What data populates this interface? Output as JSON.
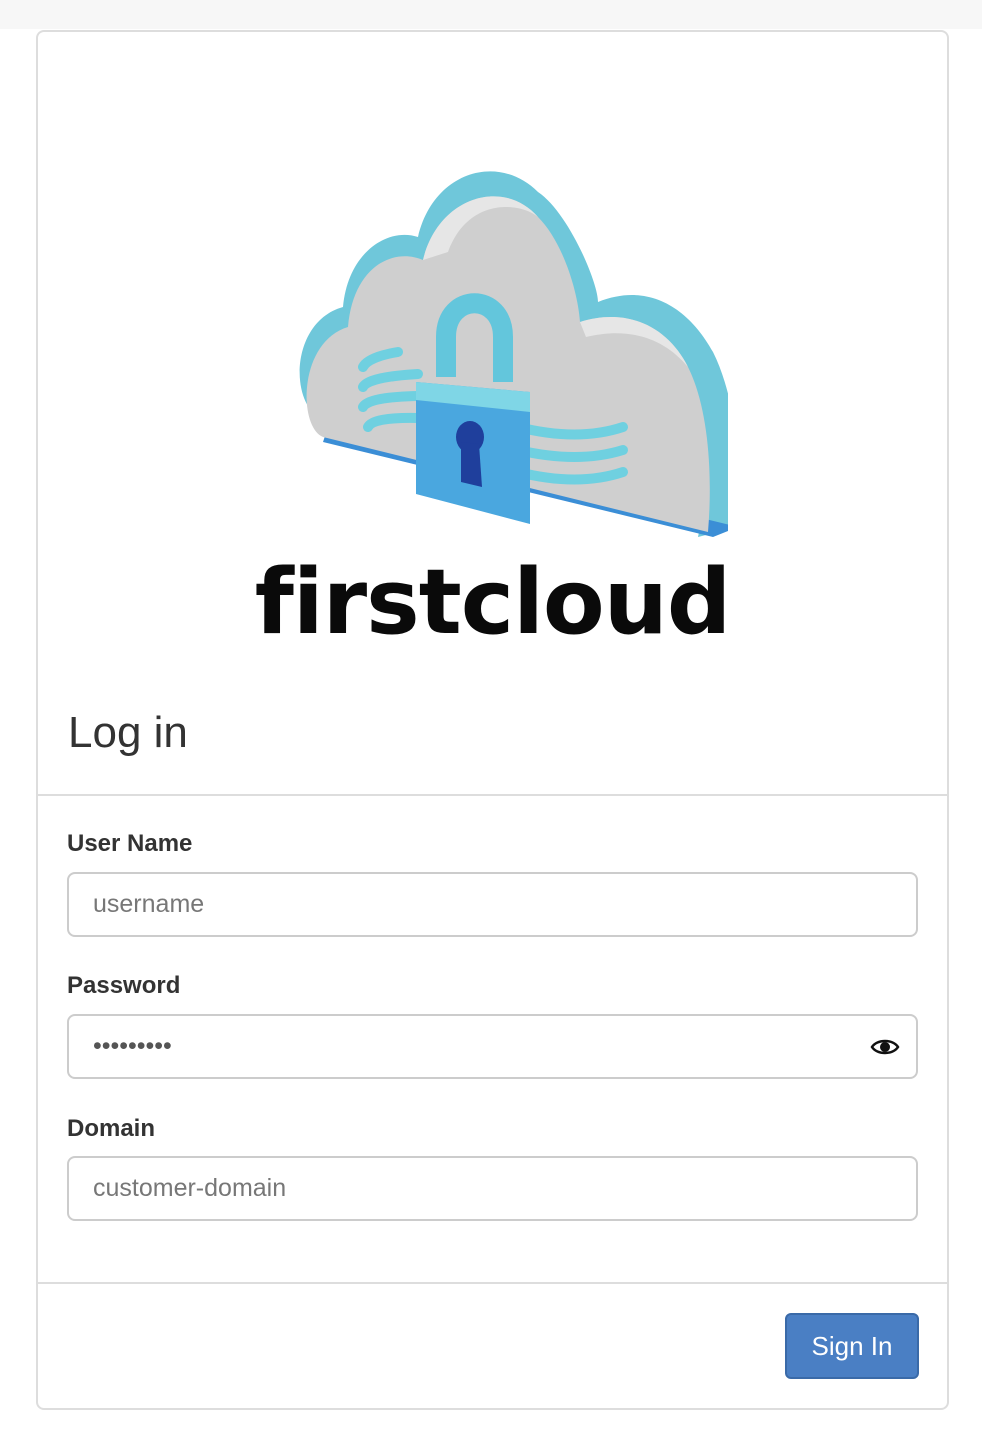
{
  "brand": {
    "name": "firstcloud"
  },
  "login": {
    "title": "Log in",
    "username": {
      "label": "User Name",
      "placeholder": "username",
      "value": ""
    },
    "password": {
      "label": "Password",
      "value": "•••••••••"
    },
    "domain": {
      "label": "Domain",
      "placeholder": "customer-domain",
      "value": ""
    },
    "submit_label": "Sign In"
  },
  "colors": {
    "primary_button": "#4a7fc4",
    "border": "#dddddd",
    "cloud_teal": "#8fd3dd",
    "lock_blue": "#2f7fd1"
  },
  "icons": {
    "logo": "cloud-lock-icon",
    "password_toggle": "eye-icon"
  }
}
